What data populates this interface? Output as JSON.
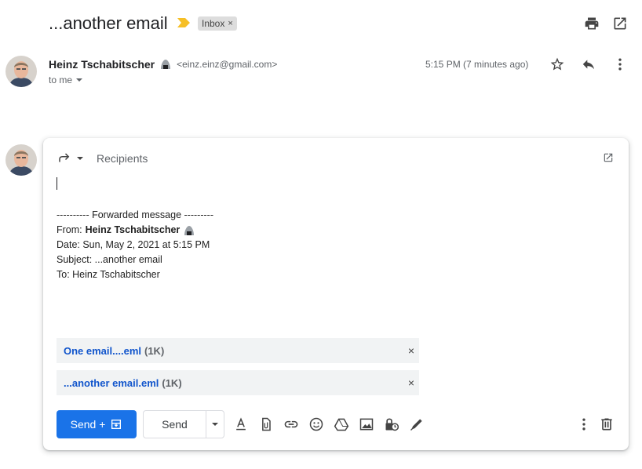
{
  "email": {
    "subject": "...another email",
    "label": "Inbox",
    "label_remove": "×",
    "sender_name": "Heinz Tschabitscher",
    "sender_email": "<einz.einz@gmail.com>",
    "recipient_line": "to me",
    "timestamp": "5:15 PM (7 minutes ago)"
  },
  "icons": {
    "importance": "importance-marker-icon",
    "print": "print-icon",
    "popout": "open-in-new-window-icon",
    "star": "star-icon",
    "reply": "reply-icon",
    "more": "more-vert-icon"
  },
  "compose": {
    "recipients_placeholder": "Recipients",
    "forward_header": "---------- Forwarded message ---------",
    "from_label": "From:",
    "from_name": "Heinz Tschabitscher",
    "date_line": "Date: Sun, May 2, 2021 at 5:15 PM",
    "subject_line": "Subject: ...another email",
    "to_line": "To: Heinz Tschabitscher",
    "attachments": [
      {
        "name": "One email....eml",
        "size": "(1K)",
        "remove": "×"
      },
      {
        "name": "...another email.eml",
        "size": "(1K)",
        "remove": "×"
      }
    ],
    "send_plus_label": "Send +",
    "send_label": "Send"
  },
  "colors": {
    "primary": "#1a73e8",
    "link": "#1155cc",
    "importance": "#f6bf26",
    "chip_bg": "#dddddd"
  }
}
